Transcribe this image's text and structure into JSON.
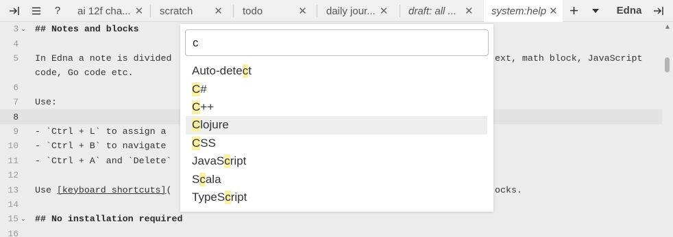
{
  "toolbar": {
    "collapse_icon": "collapse-sidebar-icon",
    "menu_icon": "hamburger-menu-icon",
    "help": "?",
    "add_tab": "+",
    "more_tabs": "▾",
    "brand": "Edna",
    "expand_icon": "expand-sidebar-icon"
  },
  "tabs": [
    {
      "label": "ai 12f cha...",
      "close": "✕",
      "italic": false,
      "active": false
    },
    {
      "label": "scratch",
      "close": "✕",
      "italic": false,
      "active": false
    },
    {
      "label": "todo",
      "close": "✕",
      "italic": false,
      "active": false
    },
    {
      "label": "daily jour...",
      "close": "✕",
      "italic": false,
      "active": false
    },
    {
      "label": "draft: all ...",
      "close": "✕",
      "italic": true,
      "active": false
    },
    {
      "label": "system:help",
      "close": "✕",
      "italic": true,
      "active": true
    }
  ],
  "editor": {
    "current_line": "8",
    "lines": [
      {
        "num": "3",
        "fold": "⌵",
        "text": "## Notes and blocks"
      },
      {
        "num": "4",
        "fold": "",
        "text": ""
      },
      {
        "num": "5",
        "fold": "",
        "text_left": "In Edna a note is divided",
        "text_right": "ext, math block, JavaScript"
      },
      {
        "num": "",
        "fold": "",
        "text": "code, Go code etc."
      },
      {
        "num": "6",
        "fold": "",
        "text": ""
      },
      {
        "num": "7",
        "fold": "",
        "text": "Use:"
      },
      {
        "num": "8",
        "fold": "",
        "text": ""
      },
      {
        "num": "9",
        "fold": "",
        "text": "- `Ctrl + L` to assign a"
      },
      {
        "num": "10",
        "fold": "",
        "text": "- `Ctrl + B` to navigate"
      },
      {
        "num": "11",
        "fold": "",
        "text": "- `Ctrl + A` and `Delete`"
      },
      {
        "num": "12",
        "fold": "",
        "text": ""
      },
      {
        "num": "13",
        "fold": "",
        "text_left_pre": "Use ",
        "text_link": "[keyboard shortcuts]",
        "text_left_post": "(",
        "text_right": "ocks."
      },
      {
        "num": "14",
        "fold": "",
        "text": ""
      },
      {
        "num": "15",
        "fold": "⌵",
        "text": "## No installation required"
      },
      {
        "num": "16",
        "fold": "",
        "text": ""
      }
    ]
  },
  "language_picker": {
    "search_value": "c",
    "search_placeholder": "",
    "selected": "Clojure",
    "options": [
      {
        "pre": "Auto-dete",
        "match": "c",
        "post": "t"
      },
      {
        "pre": "",
        "match": "C",
        "post": "#"
      },
      {
        "pre": "",
        "match": "C",
        "post": "++"
      },
      {
        "pre": "",
        "match": "C",
        "post": "lojure"
      },
      {
        "pre": "",
        "match": "C",
        "post": "SS"
      },
      {
        "pre": "JavaS",
        "match": "c",
        "post": "ript"
      },
      {
        "pre": "S",
        "match": "c",
        "post": "ala"
      },
      {
        "pre": "TypeS",
        "match": "c",
        "post": "ript"
      }
    ]
  },
  "colors": {
    "match_highlight": "#fbf0a3",
    "editor_background": "#ececec",
    "active_line": "#e2e2e2",
    "selected_option": "#eeeeee"
  }
}
